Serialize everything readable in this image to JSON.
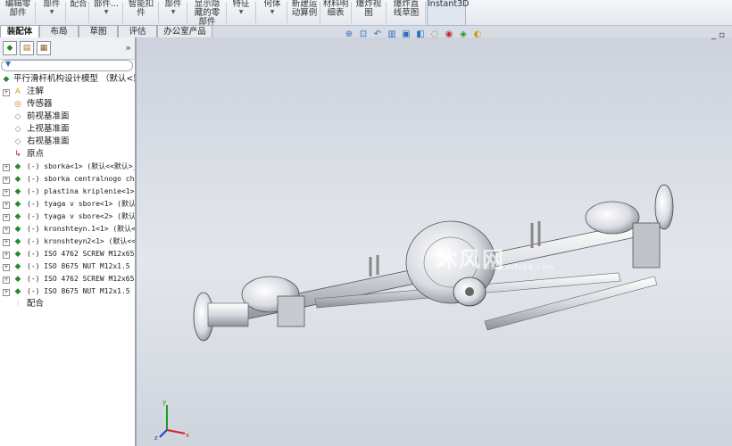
{
  "ribbon": {
    "items": [
      {
        "label": "编辑零\n部件",
        "arrow": false
      },
      {
        "label": "部件",
        "arrow": true
      },
      {
        "label": "配合",
        "arrow": false
      },
      {
        "label": "部件...",
        "arrow": true
      },
      {
        "label": "智能扣\n件",
        "arrow": false
      },
      {
        "label": "部件",
        "arrow": true
      },
      {
        "label": "显示隐\n藏的零\n部件",
        "arrow": false
      },
      {
        "label": "特征",
        "arrow": true
      },
      {
        "label": "何体",
        "arrow": true
      },
      {
        "label": "新建运\n动算例",
        "arrow": false
      },
      {
        "label": "材料明\n细表",
        "arrow": false
      },
      {
        "label": "爆炸视\n图",
        "arrow": false
      },
      {
        "label": "爆炸直\n线草图",
        "arrow": false
      },
      {
        "label": "Instant3D",
        "arrow": false
      }
    ]
  },
  "tabs": [
    "装配体",
    "布局",
    "草图",
    "评估",
    "办公室产品"
  ],
  "panel": {
    "expand_glyph": "»",
    "filter_glyph": "▼",
    "tool_icons": [
      "feature-manager-icon",
      "property-manager-icon",
      "configuration-manager-icon"
    ]
  },
  "tree": {
    "root": "平行滑杆机构设计模型 （默认<默",
    "items": [
      {
        "label": "注解",
        "icon": "A",
        "pm": "+",
        "mono": false
      },
      {
        "label": "传感器",
        "icon": "◎",
        "pm": "",
        "mono": false
      },
      {
        "label": "前视基准面",
        "icon": "◇",
        "pm": "",
        "mono": false
      },
      {
        "label": "上视基准面",
        "icon": "◇",
        "pm": "",
        "mono": false
      },
      {
        "label": "右视基准面",
        "icon": "◇",
        "pm": "",
        "mono": false
      },
      {
        "label": "原点",
        "icon": "↳",
        "pm": "",
        "mono": false
      },
      {
        "label": "(-) sborka<1> (默认<<默认>_显",
        "icon": "◆",
        "pm": "+",
        "mono": true
      },
      {
        "label": "(-) sborka centralnogo cha",
        "icon": "◆",
        "pm": "+",
        "mono": true
      },
      {
        "label": "(-) plastina kriplenie<1>",
        "icon": "◆",
        "pm": "+",
        "mono": true
      },
      {
        "label": "(-) tyaga v sbore<1> (默认",
        "icon": "◆",
        "pm": "+",
        "mono": true
      },
      {
        "label": "(-) tyaga v sbore<2> (默认",
        "icon": "◆",
        "pm": "+",
        "mono": true
      },
      {
        "label": "(-) kronshteyn.1<1> (默认<",
        "icon": "◆",
        "pm": "+",
        "mono": true
      },
      {
        "label": "(-) kronshteyn2<1> (默认<<",
        "icon": "◆",
        "pm": "+",
        "mono": true
      },
      {
        "label": "(-) ISO 4762 SCREW M12x65",
        "icon": "◆",
        "pm": "+",
        "mono": true
      },
      {
        "label": "(-) ISO 8675 NUT M12x1.5 S",
        "icon": "◆",
        "pm": "+",
        "mono": true
      },
      {
        "label": "(-) ISO 4762 SCREW M12x65",
        "icon": "◆",
        "pm": "+",
        "mono": true
      },
      {
        "label": "(-) ISO 8675 NUT M12x1.5 S",
        "icon": "◆",
        "pm": "+",
        "mono": true
      },
      {
        "label": "配合",
        "icon": "⫶",
        "pm": "",
        "mono": false
      }
    ]
  },
  "viewport": {
    "hud_icons": [
      "zoom-fit-icon",
      "zoom-area-icon",
      "previous-view-icon",
      "section-view-icon",
      "view-orientation-icon",
      "display-style-icon",
      "hide-show-icon",
      "edit-appearance-icon",
      "apply-scene-icon",
      "view-settings-icon"
    ],
    "hud_glyphs": [
      "⊕",
      "⊡",
      "↶",
      "▥",
      "▣",
      "◧",
      "◌",
      "◉",
      "◈",
      "◐"
    ],
    "window_controls": "_ ▫",
    "watermark": "沐风网",
    "watermark_url": "www.mfcad.com",
    "triad": {
      "x": "x",
      "y": "y",
      "z": "z"
    }
  },
  "colors": {
    "accent": "#2f6fbf",
    "x_axis": "#d02020",
    "y_axis": "#18a018",
    "z_axis": "#2040d0"
  }
}
